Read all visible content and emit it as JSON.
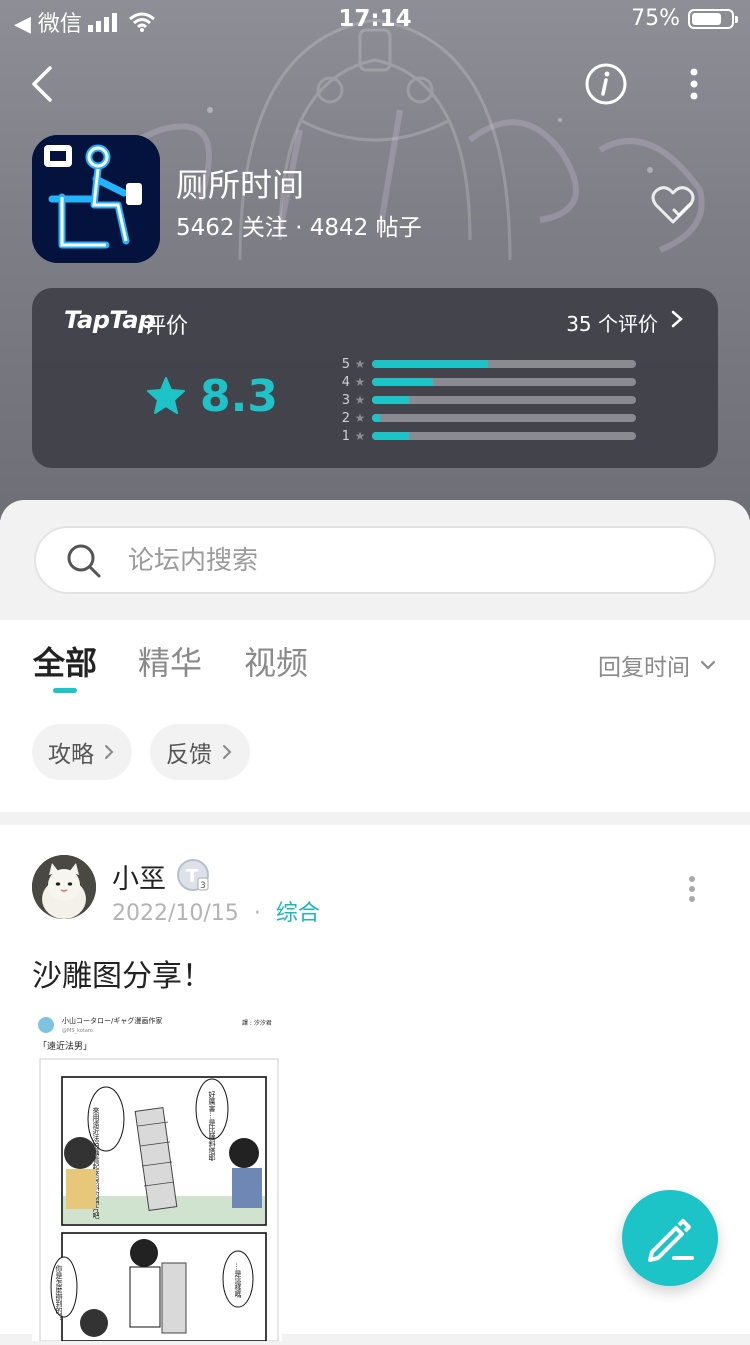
{
  "status_bar": {
    "carrier": "◀ 微信",
    "time": "17:14",
    "battery": "75%"
  },
  "app": {
    "name": "厕所时间",
    "stats": "5462 关注 · 4842 帖子"
  },
  "rating": {
    "brand": "TapTap",
    "brand_suffix": "评价",
    "count_text": "35 个评价",
    "score": "8.3",
    "distribution": [
      {
        "star": "5",
        "fraction": 0.44
      },
      {
        "star": "4",
        "fraction": 0.23
      },
      {
        "star": "3",
        "fraction": 0.14
      },
      {
        "star": "2",
        "fraction": 0.03
      },
      {
        "star": "1",
        "fraction": 0.14
      }
    ]
  },
  "search": {
    "placeholder": "论坛内搜索"
  },
  "tabs": [
    {
      "label": "全部",
      "active": true
    },
    {
      "label": "精华",
      "active": false
    },
    {
      "label": "视频",
      "active": false
    }
  ],
  "sort": {
    "label": "回复时间"
  },
  "chips": [
    {
      "label": "攻略"
    },
    {
      "label": "反馈"
    }
  ],
  "post": {
    "user": "小巠",
    "date": "2022/10/15",
    "separator": "·",
    "category": "综合",
    "title": "沙雕图分享！",
    "image_text": {
      "author": "小山コータロー/ギャグ漫画作家",
      "handle": "@MS_kotaro",
      "translator": "譯 : 汐汐君",
      "caption": "「遠近法男」",
      "bubble1": "來用遠近法拍攝看起來很斜的照片吧",
      "bubble2": "好厲害…是比薩斜塔耶",
      "bubble3": "你是怎麼辦到的？",
      "bubble4": "…是這樣嗎"
    }
  },
  "colors": {
    "accent": "#1cc4c7",
    "card": "#3c3e44"
  },
  "icons": [
    "back-icon",
    "info-icon",
    "more-icon",
    "heart-icon",
    "star-icon",
    "search-icon",
    "chevron-down-icon",
    "chevron-right-icon",
    "edit-icon"
  ]
}
